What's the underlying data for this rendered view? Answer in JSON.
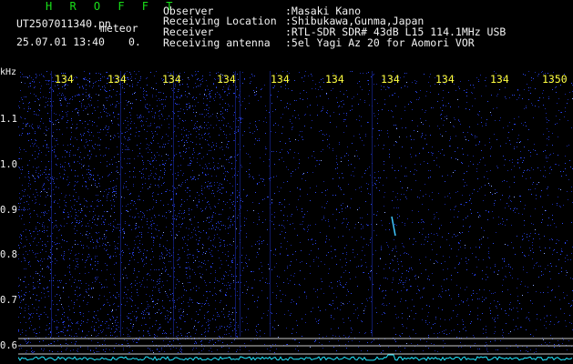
{
  "app": {
    "title": "H R O F F T"
  },
  "file": {
    "name": "UT2507011340.pn",
    "event_label": "meteor"
  },
  "capture": {
    "timestamp": "25.07.01 13:40",
    "count": "0."
  },
  "meta": [
    {
      "label": "Observer",
      "value": ":Masaki Kano"
    },
    {
      "label": "Receiving Location",
      "value": ":Shibukawa,Gunma,Japan"
    },
    {
      "label": "Receiver",
      "value": ":RTL-SDR SDR# 43dB L15 114.1MHz USB"
    },
    {
      "label": "Receiving antenna",
      "value": ":5el Yagi Az 20 for Aomori VOR"
    }
  ],
  "axis": {
    "unit": "kHz",
    "time_ticks": [
      "134",
      "134",
      "134",
      "134",
      "134",
      "134",
      "134",
      "134",
      "134",
      "1350"
    ],
    "freq_ticks": [
      "1.1",
      "1.0",
      "0.9",
      "0.8",
      "0.7",
      "0.6"
    ]
  },
  "colors": {
    "title": "#19e019",
    "ticks": "#ffff40",
    "text": "#f2f2f2",
    "noise": "#2238d8",
    "meteor": "#40c8ff",
    "power": "#20e8ff"
  }
}
